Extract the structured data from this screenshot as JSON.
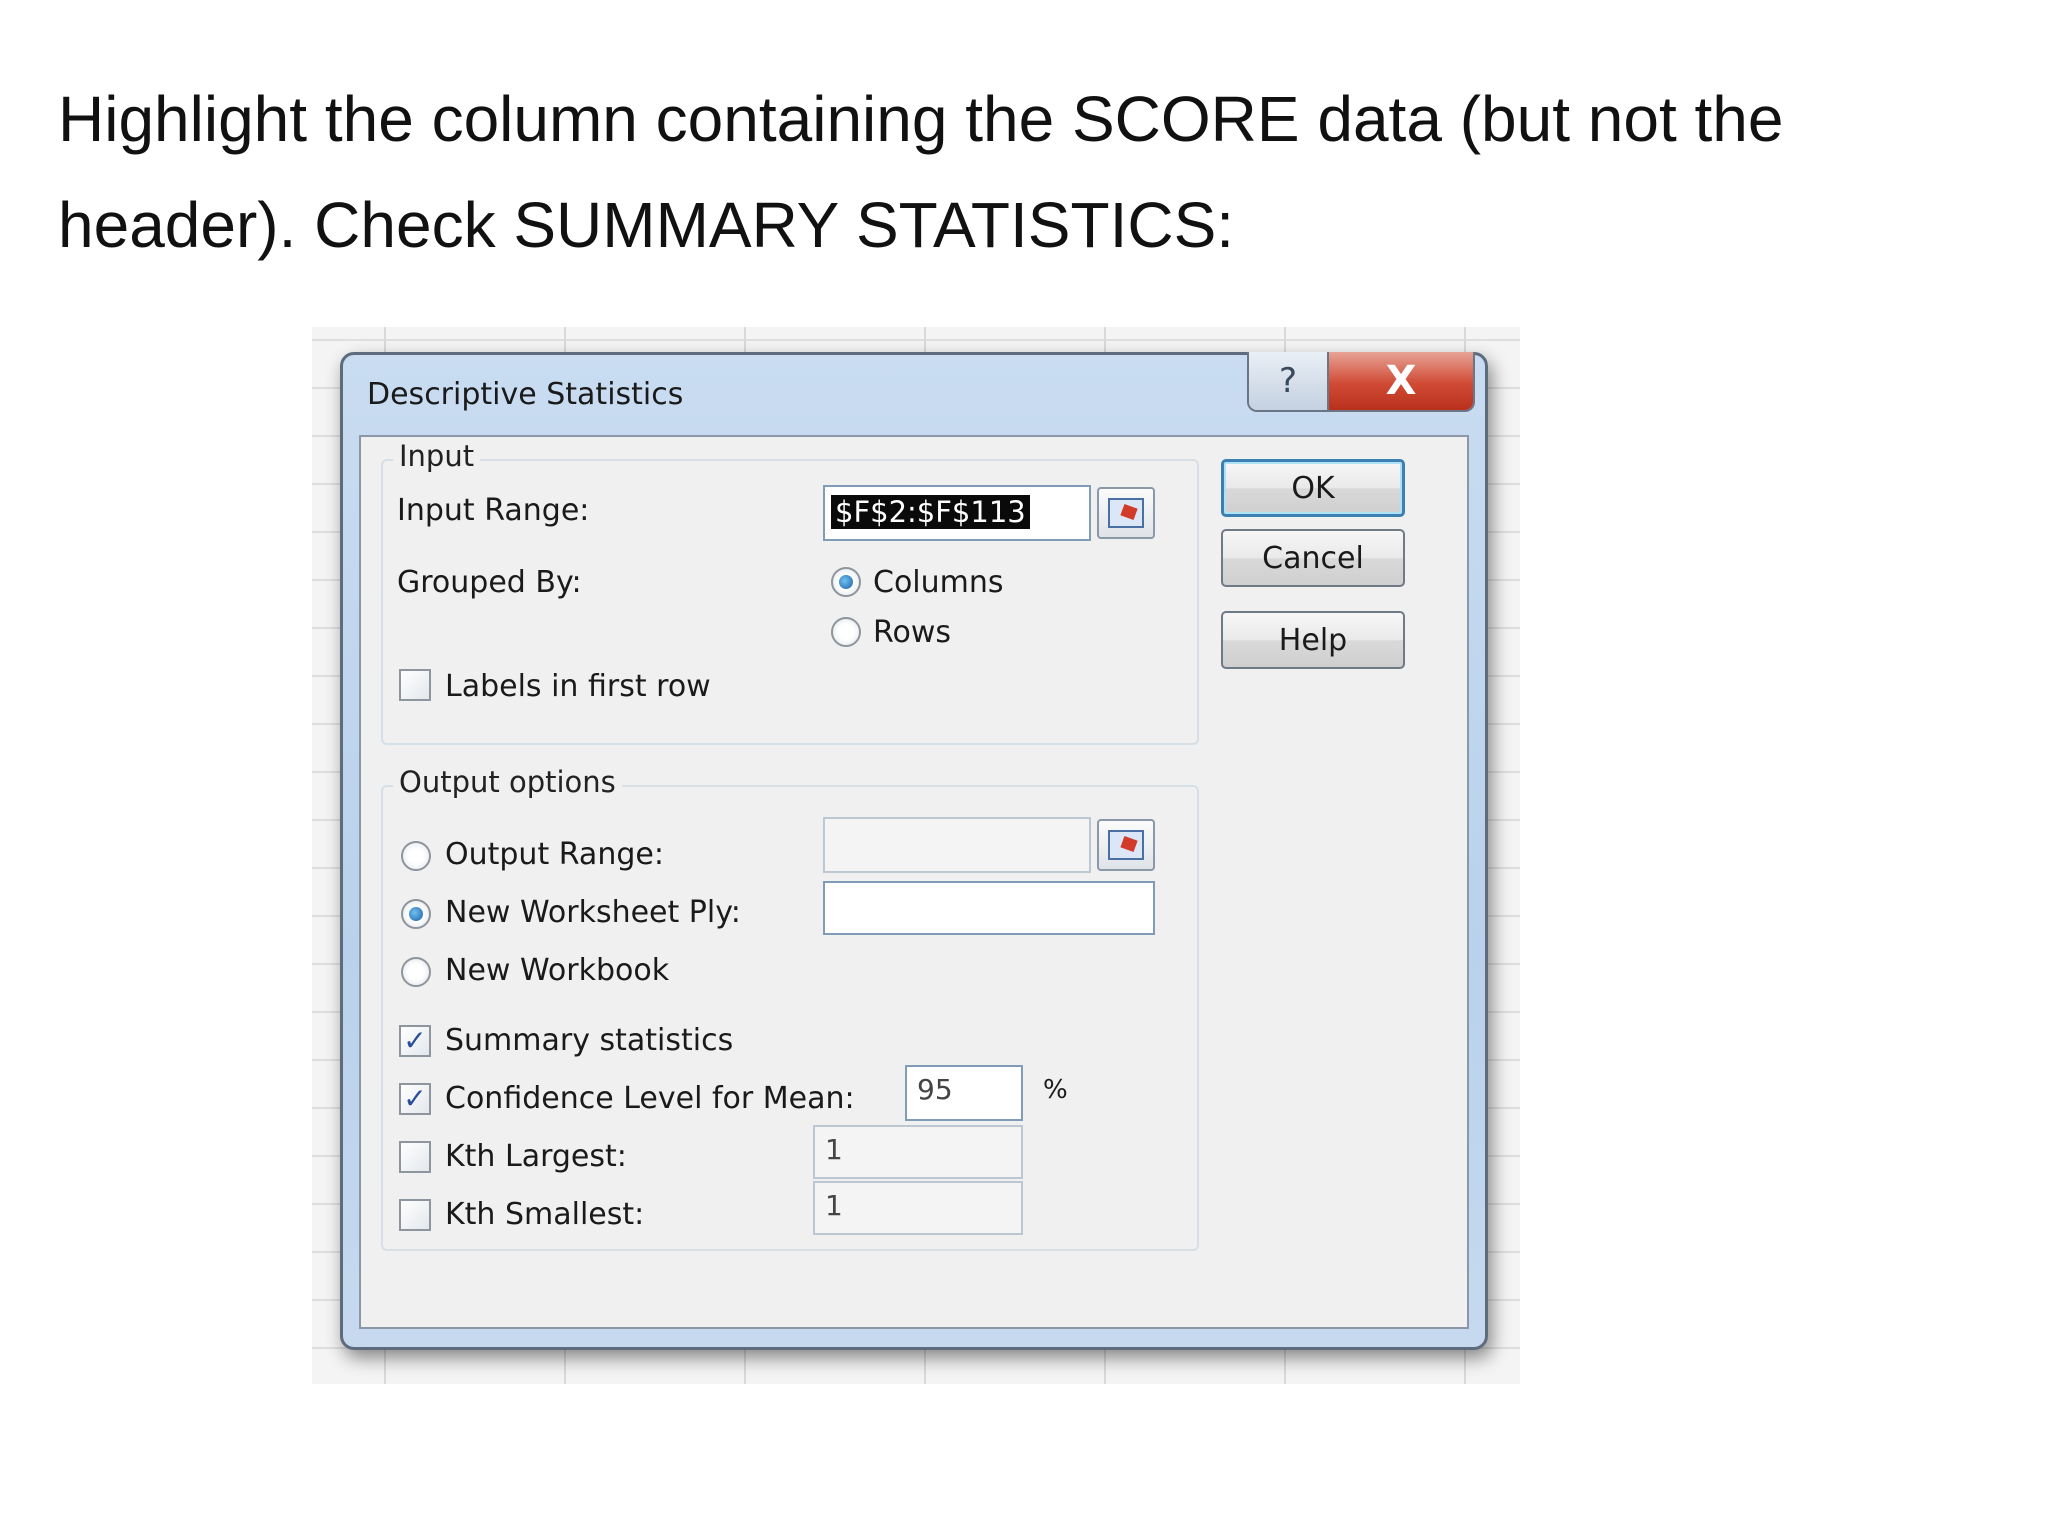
{
  "instruction": {
    "line1": "Highlight the column containing the SCORE data (but not the",
    "line2": "header).  Check SUMMARY STATISTICS:"
  },
  "dialog": {
    "title": "Descriptive Statistics",
    "help_glyph": "?",
    "close_glyph": "X",
    "input_group": {
      "legend": "Input",
      "input_range_label": "Input Range:",
      "input_range_value": "$F$2:$F$113",
      "grouped_by_label": "Grouped By:",
      "columns_label": "Columns",
      "rows_label": "Rows",
      "grouped_by_selected": "Columns",
      "labels_first_row_label": "Labels in first row",
      "labels_first_row_checked": false
    },
    "output_group": {
      "legend": "Output options",
      "output_range_label": "Output Range:",
      "output_range_value": "",
      "new_ply_label": "New Worksheet Ply:",
      "new_ply_value": "",
      "new_workbook_label": "New Workbook",
      "selected_output": "New Worksheet Ply",
      "summary_label": "Summary statistics",
      "summary_checked": true,
      "confidence_label": "Confidence Level for Mean:",
      "confidence_checked": true,
      "confidence_value": "95",
      "percent_sign": "%",
      "kth_largest_label": "Kth Largest:",
      "kth_largest_checked": false,
      "kth_largest_value": "1",
      "kth_smallest_label": "Kth Smallest:",
      "kth_smallest_checked": false,
      "kth_smallest_value": "1"
    },
    "buttons": {
      "ok": "OK",
      "cancel": "Cancel",
      "help": "Help"
    },
    "check_glyph": "✓"
  },
  "colors": {
    "title_gradient": "#c9dcf1",
    "close_red": "#d04a34",
    "selection": "#0a0a0a",
    "radio_on": "#1c5fa6"
  }
}
